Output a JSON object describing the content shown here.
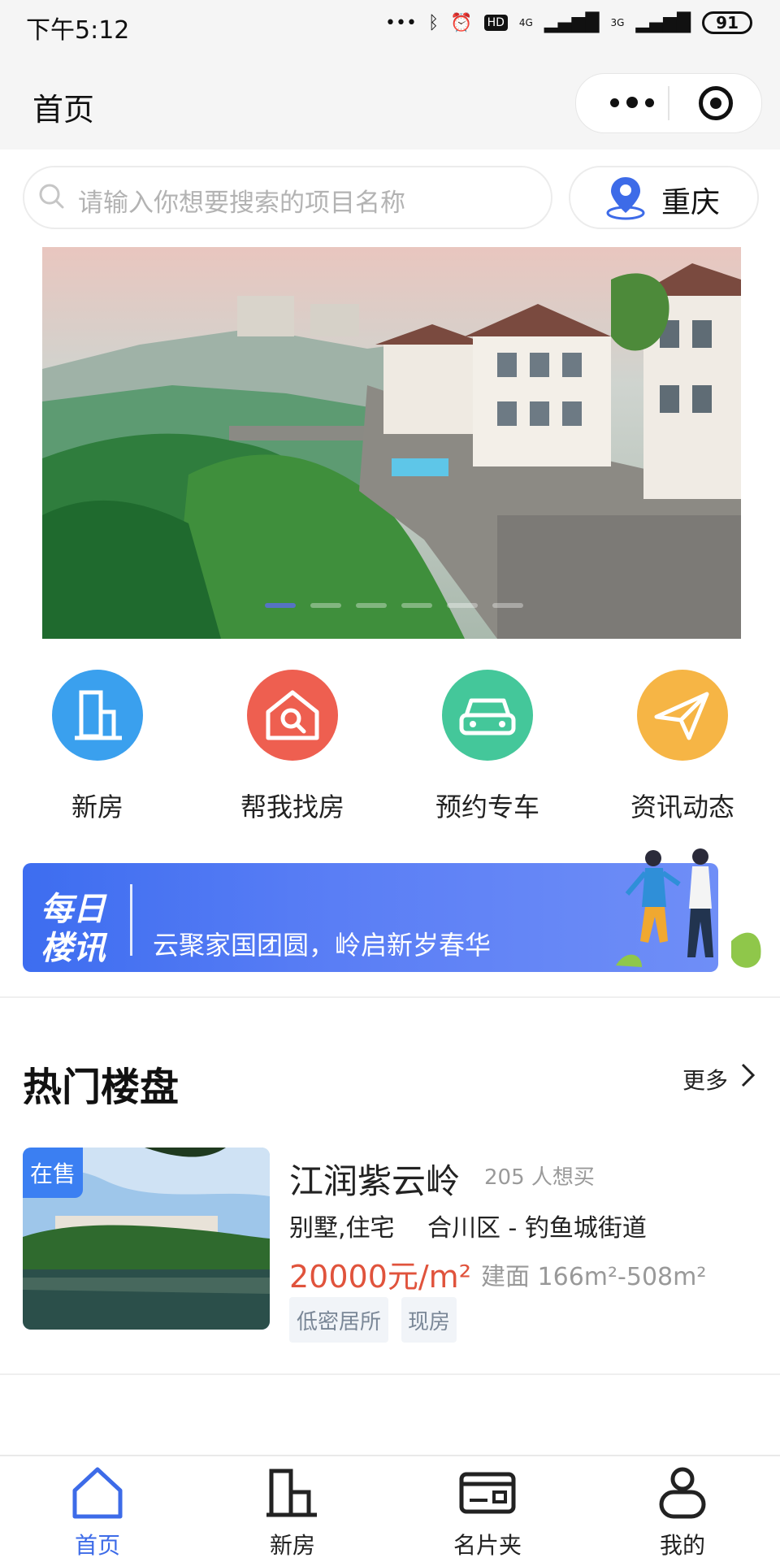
{
  "status_bar": {
    "time": "下午5:12",
    "battery": "91",
    "net1": "4G",
    "net2": "3G",
    "hd": "HD"
  },
  "nav": {
    "title": "首页"
  },
  "search": {
    "placeholder": "请输入你想要搜索的项目名称",
    "city": "重庆"
  },
  "banner": {
    "slide_count": 6,
    "active_slide": 1
  },
  "quick_menu": [
    {
      "label": "新房",
      "icon": "building-icon",
      "color": "#3aa0ee"
    },
    {
      "label": "帮我找房",
      "icon": "house-search-icon",
      "color": "#ee5f50"
    },
    {
      "label": "预约专车",
      "icon": "car-icon",
      "color": "#44c79a"
    },
    {
      "label": "资讯动态",
      "icon": "paper-plane-icon",
      "color": "#f6b545"
    }
  ],
  "daily_news": {
    "tag_line1": "每日",
    "tag_line2": "楼讯",
    "text": "云聚家国团圆，岭启新岁春华"
  },
  "hot": {
    "title": "热门楼盘",
    "more": "更多",
    "listing": {
      "status": "在售",
      "name": "江润紫云岭",
      "want": "205 人想买",
      "type": "别墅,住宅",
      "location": "合川区 - 钓鱼城街道",
      "price": "20000元/m²",
      "size": "建面 166m²-508m²",
      "tags": [
        "低密居所",
        "现房"
      ]
    }
  },
  "tabbar": [
    {
      "label": "首页",
      "icon": "home-icon",
      "active": true
    },
    {
      "label": "新房",
      "icon": "building-icon",
      "active": false
    },
    {
      "label": "名片夹",
      "icon": "card-holder-icon",
      "active": false
    },
    {
      "label": "我的",
      "icon": "user-icon",
      "active": false
    }
  ],
  "colors": {
    "accent": "#3d6be8",
    "price": "#e0533c",
    "badge": "#3b7ff2"
  }
}
